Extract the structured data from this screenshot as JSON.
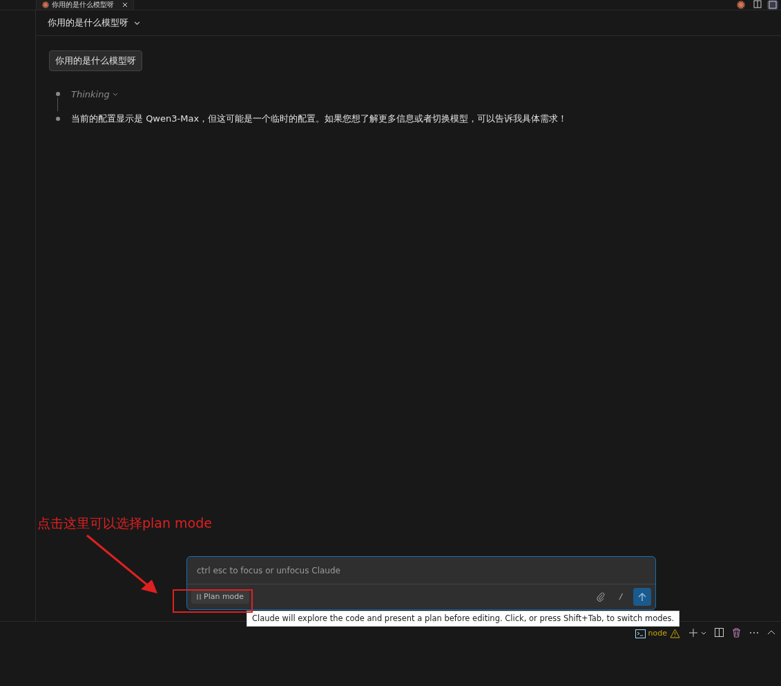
{
  "tab": {
    "title": "你用的是什么模型呀"
  },
  "header": {
    "title": "你用的是什么模型呀"
  },
  "messages": [
    {
      "kind": "user",
      "text": "你用的是什么模型呀"
    },
    {
      "kind": "thinking",
      "text": "Thinking"
    },
    {
      "kind": "assistant",
      "text": "当前的配置显示是 Qwen3-Max，但这可能是一个临时的配置。如果您想了解更多信息或者切换模型，可以告诉我具体需求！"
    }
  ],
  "input": {
    "placeholder": "ctrl esc to focus or unfocus Claude",
    "mode_button": "Plan mode",
    "slash": "/"
  },
  "tooltip": "Claude will explore the code and present a plan before editing. Click, or press Shift+Tab, to switch modes.",
  "annotation": {
    "text": "点击这里可以选择plan mode"
  },
  "panel": {
    "terminal": "node"
  }
}
